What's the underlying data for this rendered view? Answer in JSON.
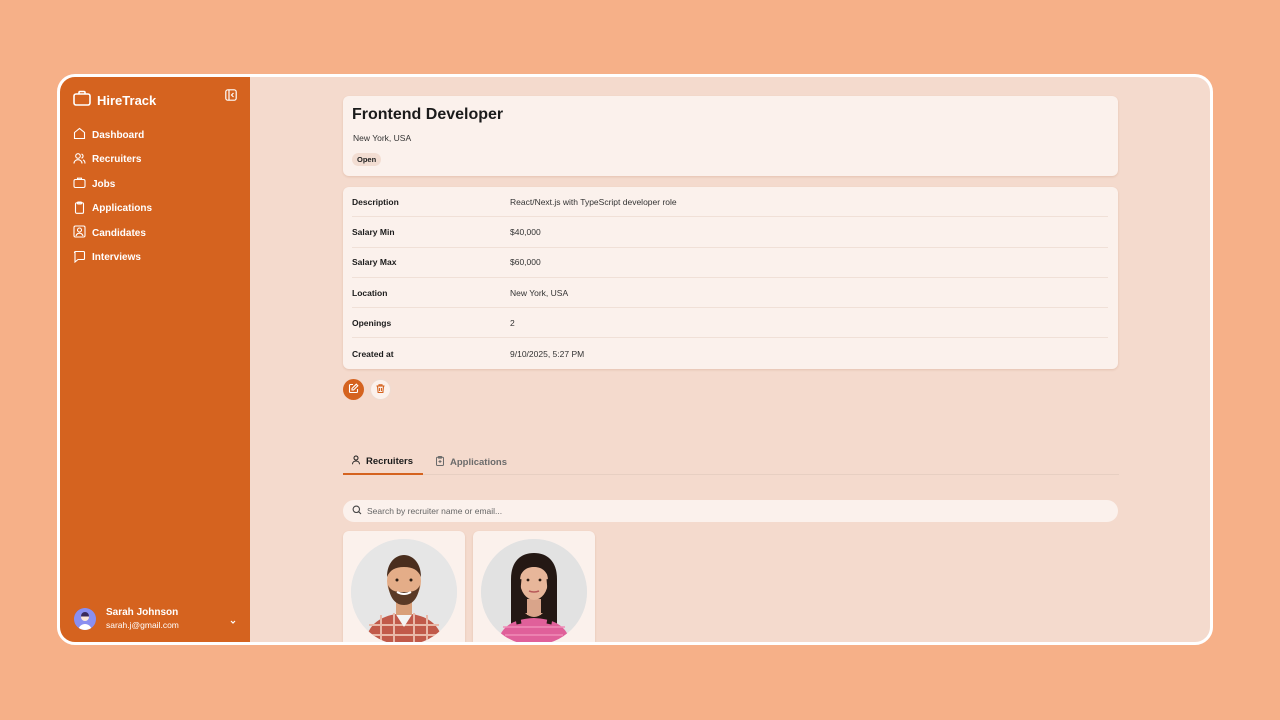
{
  "app": {
    "brand": "HireTrack",
    "accent_color": "#d5631f",
    "background_color": "#f6b088"
  },
  "sidebar": {
    "items": [
      {
        "label": "Dashboard",
        "icon": "home-icon"
      },
      {
        "label": "Recruiters",
        "icon": "users-icon"
      },
      {
        "label": "Jobs",
        "icon": "briefcase-icon"
      },
      {
        "label": "Applications",
        "icon": "clipboard-icon"
      },
      {
        "label": "Candidates",
        "icon": "contact-icon"
      },
      {
        "label": "Interviews",
        "icon": "message-icon"
      }
    ],
    "user": {
      "name": "Sarah Johnson",
      "email": "sarah.j@gmail.com"
    }
  },
  "job": {
    "title": "Frontend Developer",
    "location": "New York, USA",
    "status": "Open"
  },
  "details": [
    {
      "label": "Description",
      "value": "React/Next.js with TypeScript developer role"
    },
    {
      "label": "Salary Min",
      "value": "$40,000"
    },
    {
      "label": "Salary Max",
      "value": "$60,000"
    },
    {
      "label": "Location",
      "value": "New York, USA"
    },
    {
      "label": "Openings",
      "value": "2"
    },
    {
      "label": "Created at",
      "value": "9/10/2025, 5:27 PM"
    }
  ],
  "tabs": [
    {
      "label": "Recruiters",
      "active": true
    },
    {
      "label": "Applications",
      "active": false
    }
  ],
  "search": {
    "placeholder": "Search by recruiter name or email..."
  }
}
